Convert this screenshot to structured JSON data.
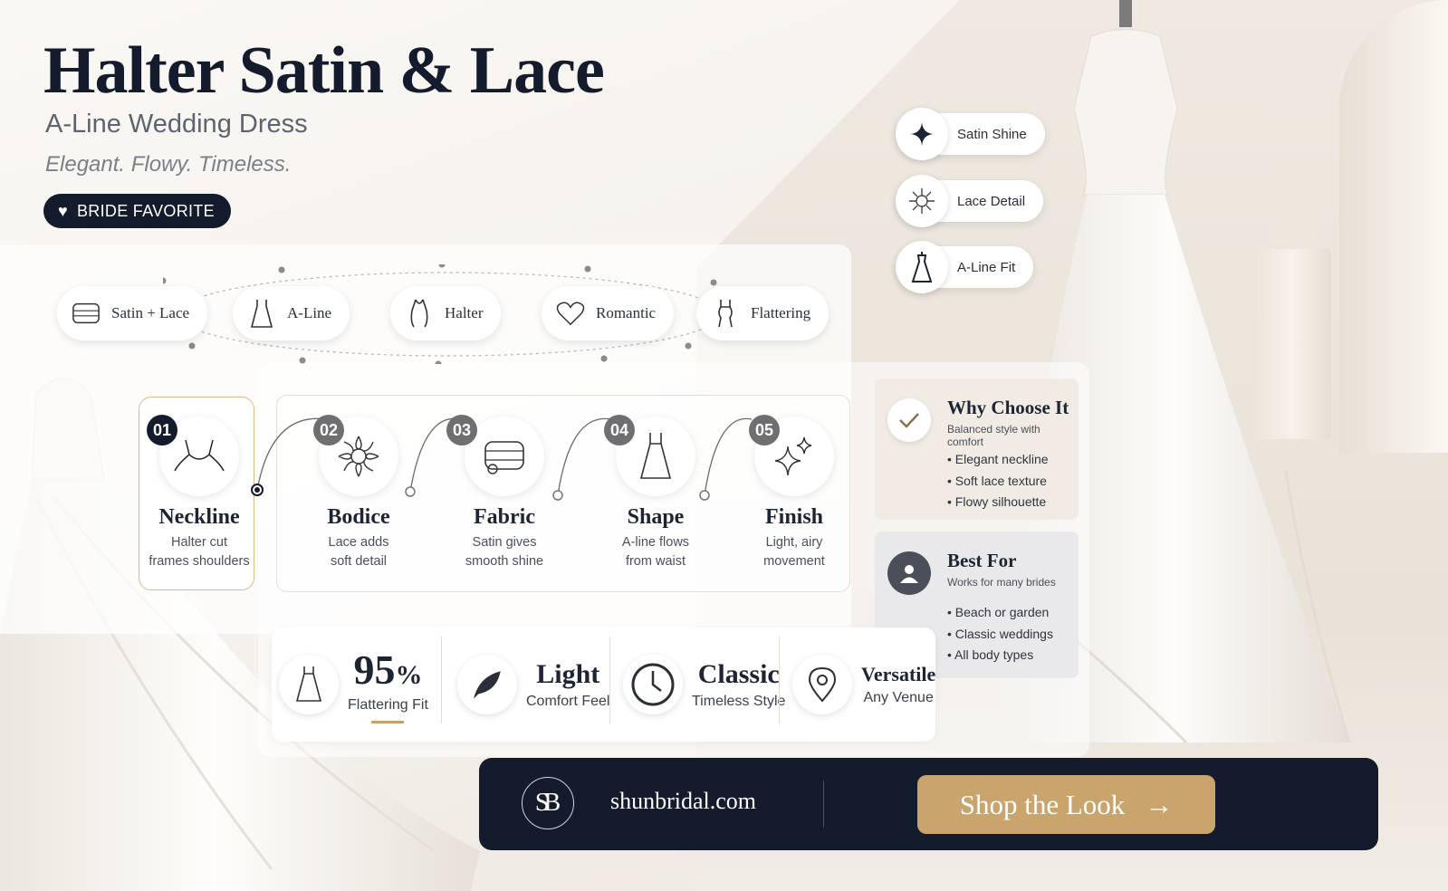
{
  "header": {
    "title": "Halter Satin & Lace",
    "subtitle": "A-Line Wedding Dress",
    "tagline": "Elegant. Flowy. Timeless.",
    "badge": "BRIDE FAVORITE"
  },
  "features": [
    {
      "label": "Satin + Lace",
      "icon": "fabric-icon"
    },
    {
      "label": "A-Line",
      "icon": "dress-icon"
    },
    {
      "label": "Halter",
      "icon": "halter-icon"
    },
    {
      "label": "Romantic",
      "icon": "heart-icon"
    },
    {
      "label": "Flattering",
      "icon": "figure-icon"
    }
  ],
  "side_features": [
    {
      "label": "Satin Shine",
      "icon": "sparkle-icon"
    },
    {
      "label": "Lace Detail",
      "icon": "lace-icon"
    },
    {
      "label": "A-Line Fit",
      "icon": "dress-form-icon"
    }
  ],
  "steps": [
    {
      "num": "01",
      "name": "Neckline",
      "desc1": "Halter cut",
      "desc2": "frames shoulders"
    },
    {
      "num": "02",
      "name": "Bodice",
      "desc1": "Lace adds",
      "desc2": "soft detail"
    },
    {
      "num": "03",
      "name": "Fabric",
      "desc1": "Satin gives",
      "desc2": "smooth shine"
    },
    {
      "num": "04",
      "name": "Shape",
      "desc1": "A-line flows",
      "desc2": "from waist"
    },
    {
      "num": "05",
      "name": "Finish",
      "desc1": "Light, airy",
      "desc2": "movement"
    }
  ],
  "why": {
    "title": "Why Choose It",
    "sub": "Balanced style with comfort",
    "items": [
      "Elegant neckline",
      "Soft lace texture",
      "Flowy silhouette"
    ]
  },
  "best": {
    "title": "Best For",
    "sub": "Works for many brides",
    "items": [
      "Beach or garden",
      "Classic weddings",
      "All body types"
    ]
  },
  "stats": [
    {
      "value": "95",
      "unit": "%",
      "label": "Flattering Fit"
    },
    {
      "value": "Light",
      "label": "Comfort Feel"
    },
    {
      "value": "Classic",
      "label": "Timeless Style"
    },
    {
      "value": "Versatile",
      "label": "Any Venue"
    }
  ],
  "cta": {
    "logo": "SB",
    "site": "shunbridal.com",
    "button": "Shop the Look",
    "arrow": "→"
  },
  "colors": {
    "navy": "#141b2d",
    "gold": "#c9a46c",
    "cream": "#f6f3ef"
  }
}
